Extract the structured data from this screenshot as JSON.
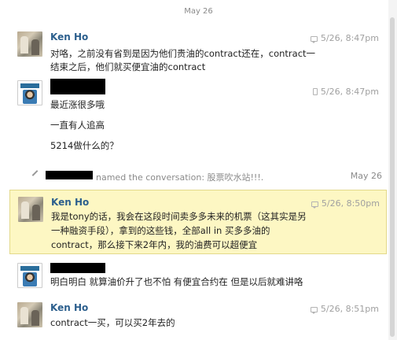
{
  "date_divider": "May 26",
  "messages": [
    {
      "sender": "Ken Ho",
      "time": "5/26, 8:47pm",
      "lines": [
        "对咯，之前没有省到是因为他们贵油的contract还在，contract一",
        "结束之后，他们就买便宜油的contract"
      ]
    },
    {
      "sender": "",
      "time": "5/26, 8:47pm",
      "lines": [
        "最近涨很多哦",
        "一直有人追高",
        "5214做什么的？"
      ]
    },
    {
      "sender": "Ken Ho",
      "time": "5/26, 8:50pm",
      "lines": [
        "我是tony的话，我会在这段时间卖多多未来的机票（这其实是另",
        "一种融资手段），拿到的这些钱，全部all in 买多多油的",
        "contract，那么接下来2年内，我的油费可以超便宜"
      ]
    },
    {
      "sender": "",
      "time": "",
      "lines": [
        "明白明白 就算油价升了也不怕 有便宜合约在 但是以后就难讲咯"
      ]
    },
    {
      "sender": "Ken Ho",
      "time": "5/26, 8:51pm",
      "lines": [
        "contract一买，可以买2年去的"
      ]
    }
  ],
  "system_event": {
    "text": "named the conversation: 股票吹水站!!!.",
    "date": "May 26"
  },
  "icons": {
    "chat_source": "chat-bubble-icon",
    "mobile_source": "mobile-phone-icon",
    "rename": "pencil-icon"
  }
}
